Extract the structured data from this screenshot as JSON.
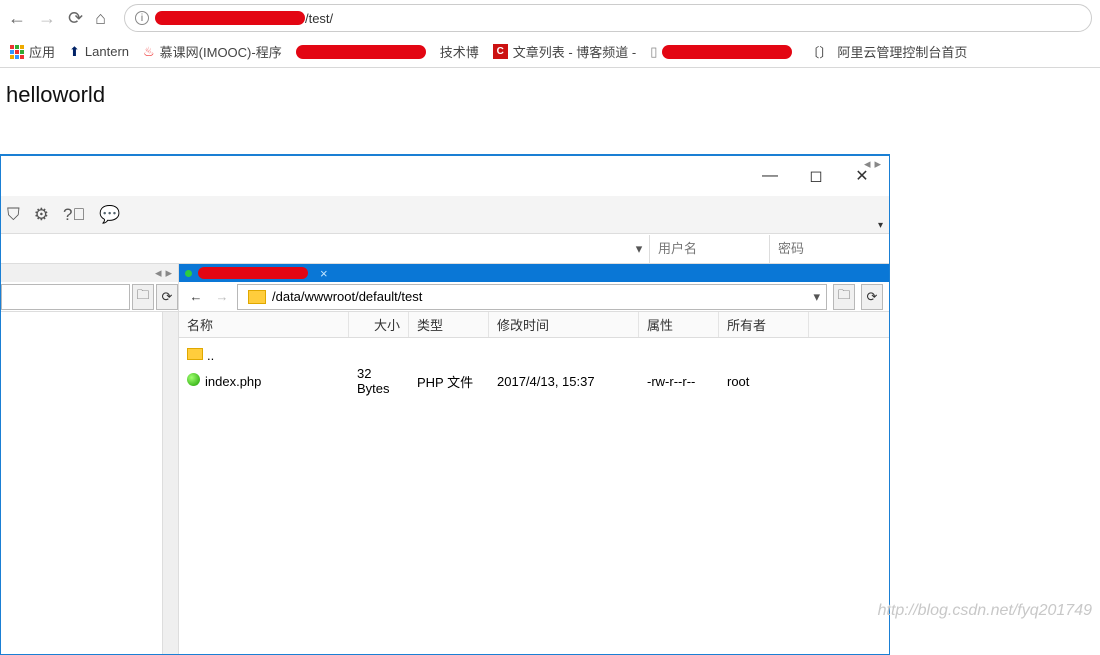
{
  "browser": {
    "url_suffix": "/test/",
    "bookmarks": {
      "apps": "应用",
      "lantern": "Lantern",
      "imooc": "慕课网(IMOOC)-程序",
      "tech": "技术博",
      "blog": "文章列表 - 博客频道 -",
      "aliyun": "阿里云管理控制台首页"
    }
  },
  "page_content": "helloworld",
  "ftp": {
    "quick": {
      "user_ph": "用户名",
      "pass_ph": "密码"
    },
    "path": "/data/wwwroot/default/test",
    "cols": {
      "name": "名称",
      "size": "大小",
      "type": "类型",
      "mtime": "修改时间",
      "perm": "属性",
      "owner": "所有者"
    },
    "rows": {
      "parent": "..",
      "file": {
        "name": "index.php",
        "size": "32 Bytes",
        "type": "PHP 文件",
        "mtime": "2017/4/13, 15:37",
        "perm": "-rw-r--r--",
        "owner": "root"
      }
    }
  },
  "watermark": "http://blog.csdn.net/fyq201749"
}
